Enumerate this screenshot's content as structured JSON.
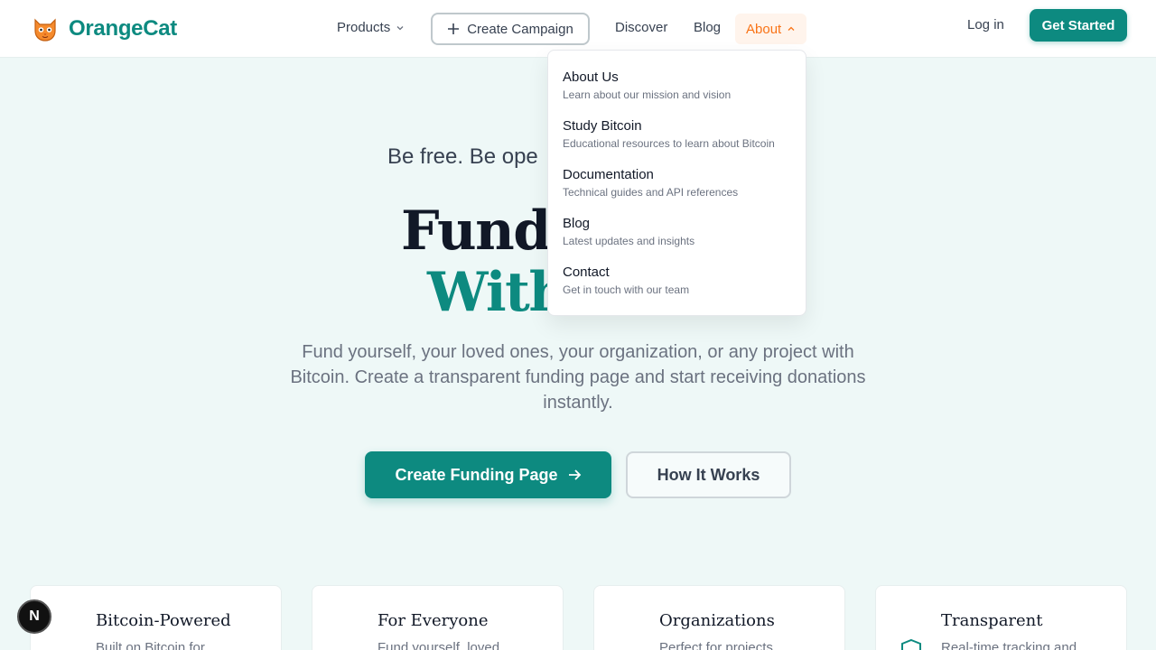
{
  "header": {
    "logo_text": "OrangeCat",
    "logo_icon": "cat-face-icon",
    "nav": {
      "products": "Products",
      "create_campaign": "Create Campaign",
      "discover": "Discover",
      "blog": "Blog",
      "about": "About"
    },
    "login": "Log in",
    "get_started": "Get Started"
  },
  "hero": {
    "tagline": "Be free. Be ope",
    "title_line1": "Fund A",
    "title_line2": "With",
    "description": "Fund yourself, your loved ones, your organization, or any project with Bitcoin. Create a transparent funding page and start receiving donations instantly.",
    "primary_button": "Create Funding Page",
    "secondary_button": "How It Works"
  },
  "about_menu": [
    {
      "title": "About Us",
      "desc": "Learn about our mission and vision"
    },
    {
      "title": "Study Bitcoin",
      "desc": "Educational resources to learn about Bitcoin"
    },
    {
      "title": "Documentation",
      "desc": "Technical guides and API references"
    },
    {
      "title": "Blog",
      "desc": "Latest updates and insights"
    },
    {
      "title": "Contact",
      "desc": "Get in touch with our team"
    }
  ],
  "features": [
    {
      "title": "Bitcoin-Powered",
      "desc": "Built on Bitcoin for"
    },
    {
      "title": "For Everyone",
      "desc": "Fund yourself, loved"
    },
    {
      "title": "Organizations",
      "desc": "Perfect for projects"
    },
    {
      "title": "Transparent",
      "desc": "Real-time tracking and"
    }
  ],
  "badge": "N",
  "colors": {
    "brand": "#0d8a80",
    "accent": "#f97316",
    "background": "#eef8f7"
  }
}
